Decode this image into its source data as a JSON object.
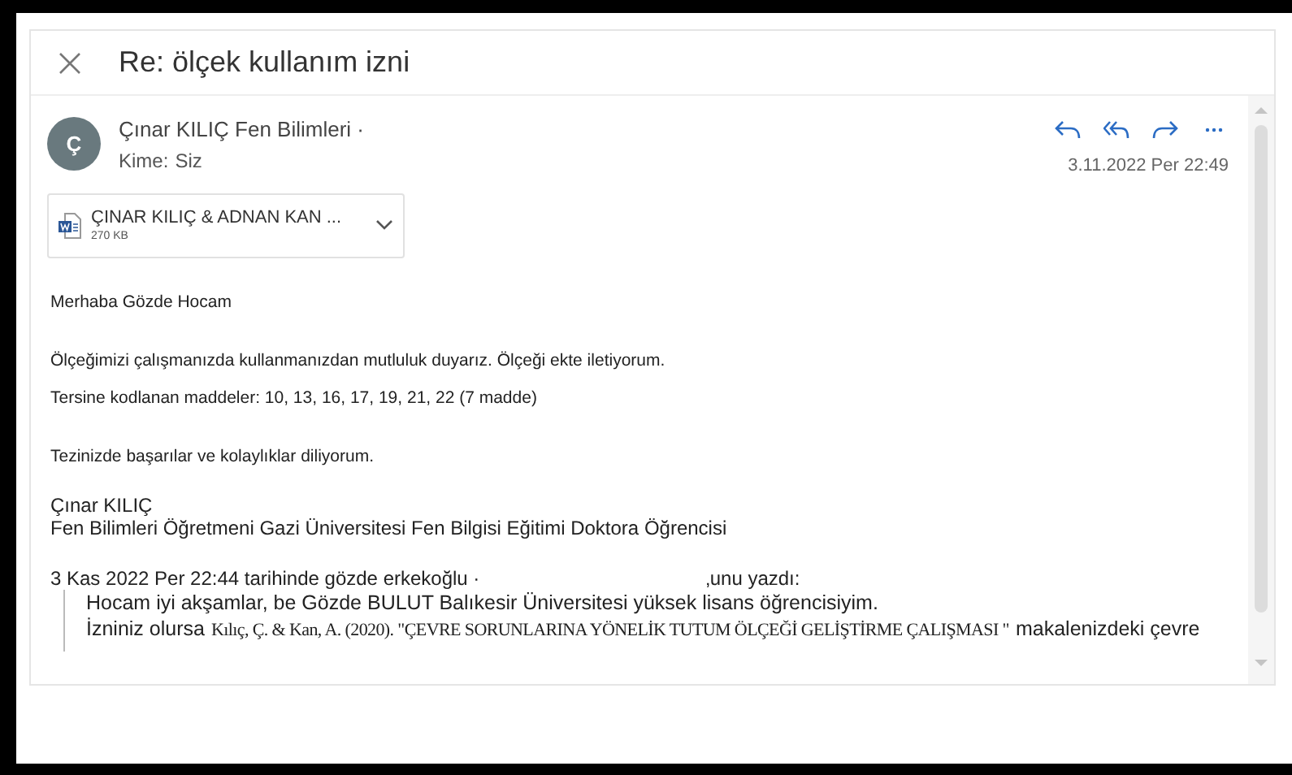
{
  "subject": "Re: ölçek kullanım izni",
  "message": {
    "avatar": "Ç",
    "sender": "Çınar KILIÇ Fen Bilimleri ·",
    "to_label": "Kime:",
    "to": "Siz",
    "date": "3.11.2022 Per 22:49"
  },
  "attachment": {
    "name": "ÇINAR KILIÇ & ADNAN KAN ...",
    "size": "270 KB"
  },
  "body": [
    "Merhaba Gözde Hocam",
    "Ölçeğimizi çalışmanızda kullanmanızdan mutluluk duyarız. Ölçeği ekte iletiyorum.",
    "Tersine kodlanan maddeler: 10, 13, 16, 17, 19, 21, 22 (7 madde)",
    "Tezinizde başarılar ve kolaylıklar diliyorum."
  ],
  "signature": [
    "Çınar KILIÇ",
    "Fen Bilimleri Öğretmeni Gazi Üniversitesi Fen Bilgisi Eğitimi Doktora Öğrencisi"
  ],
  "quote_header": [
    "3 Kas 2022 Per 22:44 tarihinde gözde erkekoğlu ·",
    "‚unu yazdı:"
  ],
  "quoted": [
    {
      "segments": [
        {
          "kind": "sans",
          "text": "Hocam iyi akşamlar, be Gözde BULUT Balıkesir Üniversitesi yüksek lisans öğrencisiyim."
        }
      ]
    },
    {
      "segments": [
        {
          "kind": "sans",
          "text": "İzniniz olursa"
        },
        {
          "kind": "serif",
          "text": "Kılıç, Ç. & Kan, A. (2020). \"ÇEVRE SORUNLARINA YÖNELİK TUTUM ÖLÇEĞİ GELİŞTİRME ÇALIŞMASI \""
        },
        {
          "kind": "sans",
          "text": "makalenizdeki çevre"
        }
      ]
    }
  ]
}
